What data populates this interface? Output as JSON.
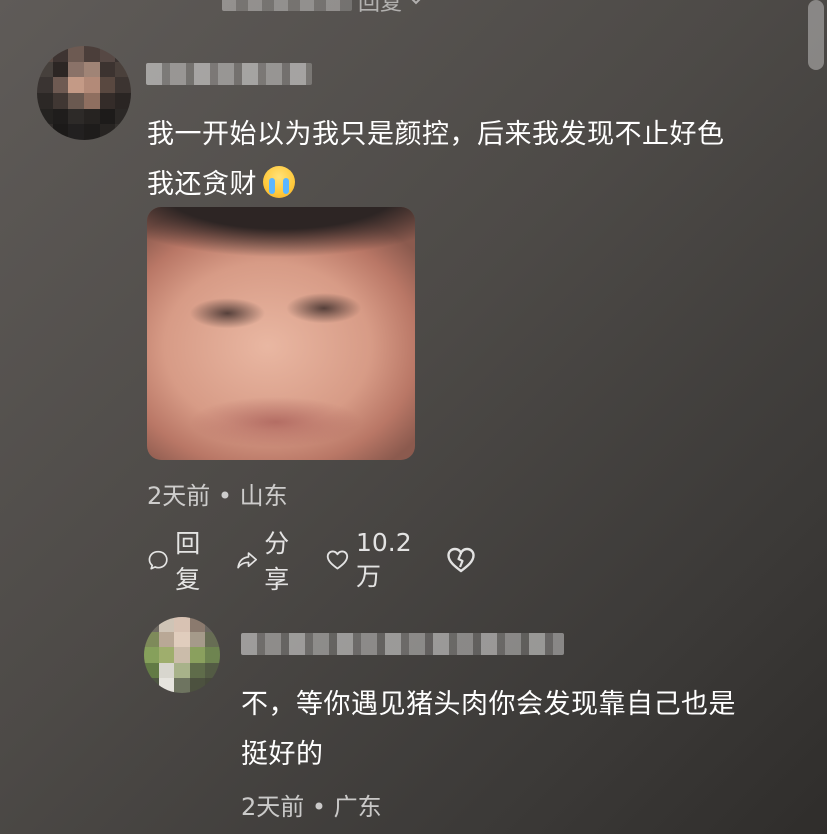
{
  "partial_top": {
    "reply_label": "回复"
  },
  "comment": {
    "text_line1": "我一开始以为我只是颜控，后来我发现不止好色",
    "text_line2": "我还贪财",
    "emoji": "loudly-crying-face",
    "meta": "2天前 • 山东",
    "actions": {
      "reply_label": "回复",
      "share_label": "分享",
      "like_count": "10.2万"
    }
  },
  "reply": {
    "text_line1": "不，等你遇见猪头肉你会发现靠自己也是",
    "text_line2": "挺好的",
    "meta": "2天前 • 广东"
  },
  "colors": {
    "background": "#4d4a47",
    "text": "#ffffff",
    "meta_text": "#bdbab7"
  }
}
